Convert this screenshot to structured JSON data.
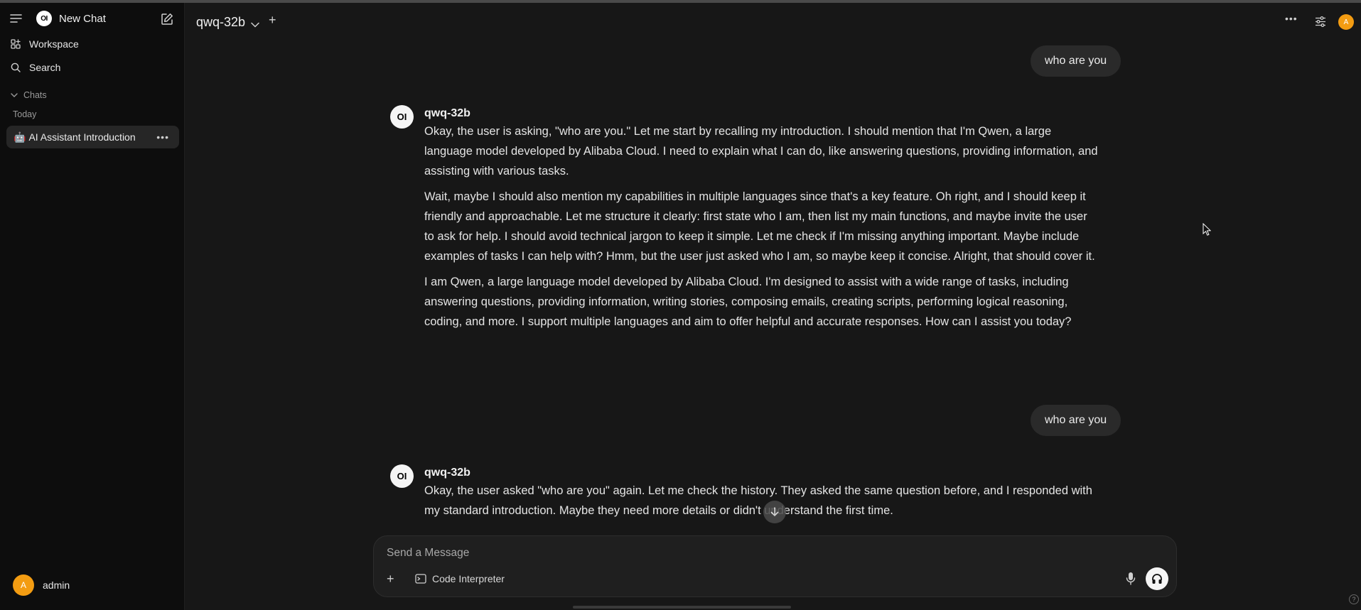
{
  "sidebar": {
    "new_chat_label": "New Chat",
    "workspace_label": "Workspace",
    "search_label": "Search",
    "chats_section": "Chats",
    "today_label": "Today",
    "chat_items": [
      {
        "emoji": "🤖",
        "label": "AI Assistant Introduction"
      }
    ],
    "user": {
      "avatar_letter": "A",
      "name": "admin"
    }
  },
  "header": {
    "model": "qwq-32b",
    "user_avatar_letter": "A"
  },
  "messages": [
    {
      "role": "user",
      "text": "who are you"
    },
    {
      "role": "assistant",
      "model": "qwq-32b",
      "paragraphs": [
        "Okay, the user is asking, \"who are you.\" Let me start by recalling my introduction. I should mention that I'm Qwen, a large language model developed by Alibaba Cloud. I need to explain what I can do, like answering questions, providing information, and assisting with various tasks.",
        "Wait, maybe I should also mention my capabilities in multiple languages since that's a key feature. Oh right, and I should keep it friendly and approachable. Let me structure it clearly: first state who I am, then list my main functions, and maybe invite the user to ask for help. I should avoid technical jargon to keep it simple. Let me check if I'm missing anything important. Maybe include examples of tasks I can help with? Hmm, but the user just asked who I am, so maybe keep it concise. Alright, that should cover it.",
        "I am Qwen, a large language model developed by Alibaba Cloud. I'm designed to assist with a wide range of tasks, including answering questions, providing information, writing stories, composing emails, creating scripts, performing logical reasoning, coding, and more. I support multiple languages and aim to offer helpful and accurate responses. How can I assist you today?"
      ]
    },
    {
      "role": "user",
      "text": "who are you"
    },
    {
      "role": "assistant",
      "model": "qwq-32b",
      "paragraphs": [
        "Okay, the user asked \"who are you\" again. Let me check the history. They asked the same question before, and I responded with my standard introduction. Maybe they need more details or didn't understand the first time."
      ]
    }
  ],
  "composer": {
    "placeholder": "Send a Message",
    "code_interpreter_label": "Code Interpreter"
  },
  "colors": {
    "sidebar_bg": "#0d0d0d",
    "main_bg": "#171717",
    "selected_chat_bg": "#262626",
    "user_bubble_bg": "#2a2a2a",
    "avatar_orange": "#f39c12"
  },
  "logo_text": "OI"
}
